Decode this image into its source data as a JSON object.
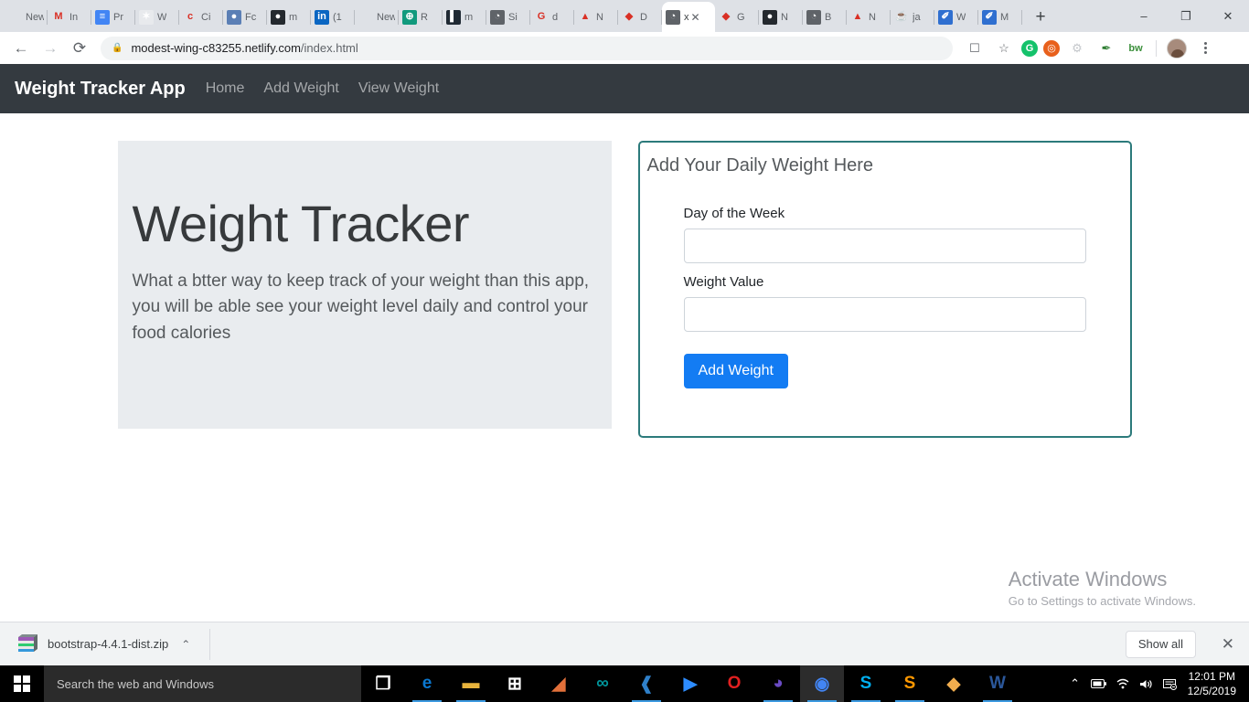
{
  "browser": {
    "tabs": [
      {
        "label": "New T",
        "icon": "blank-page-icon",
        "color": "#ffffff",
        "glyph": "",
        "active": false
      },
      {
        "label": "In",
        "icon": "gmail-icon",
        "color": "#ffffff",
        "glyph": "M",
        "active": false
      },
      {
        "label": "Pr",
        "icon": "google-docs-icon",
        "color": "#4285f4",
        "glyph": "≡",
        "active": false
      },
      {
        "label": "W",
        "icon": "asterisk-icon",
        "color": "#e8eaed",
        "glyph": "✶",
        "active": false
      },
      {
        "label": "Ci",
        "icon": "terminal-icon",
        "color": "#ffffff",
        "glyph": "c",
        "active": false
      },
      {
        "label": "Fc",
        "icon": "oval-icon",
        "color": "#5b7fb5",
        "glyph": "●",
        "active": false
      },
      {
        "label": "m",
        "icon": "github-icon",
        "color": "#24292e",
        "glyph": "●",
        "active": false
      },
      {
        "label": "(1",
        "icon": "linkedin-icon",
        "color": "#0a66c2",
        "glyph": "in",
        "active": false
      },
      {
        "label": "New T",
        "icon": "blank-page-icon",
        "color": "#ffffff",
        "glyph": "",
        "active": false
      },
      {
        "label": "R",
        "icon": "green-globe-icon",
        "color": "#119a7d",
        "glyph": "⊕",
        "active": false
      },
      {
        "label": "m",
        "icon": "dark-book-icon",
        "color": "#1f2933",
        "glyph": "▌",
        "active": false
      },
      {
        "label": "Si",
        "icon": "globe-icon",
        "color": "#5f6368",
        "glyph": "◔",
        "active": false
      },
      {
        "label": "d",
        "icon": "google-icon",
        "color": "#ffffff",
        "glyph": "G",
        "active": false
      },
      {
        "label": "N",
        "icon": "orange-lamp-icon",
        "color": "#ffffff",
        "glyph": "▲",
        "active": false
      },
      {
        "label": "D",
        "icon": "teal-diamond-icon",
        "color": "#ffffff",
        "glyph": "◆",
        "active": false
      },
      {
        "label": "x",
        "icon": "globe-icon",
        "color": "#5f6368",
        "glyph": "◔",
        "active": true
      },
      {
        "label": "G",
        "icon": "teal-diamond-icon",
        "color": "#ffffff",
        "glyph": "◆",
        "active": false
      },
      {
        "label": "N",
        "icon": "github-icon",
        "color": "#24292e",
        "glyph": "●",
        "active": false
      },
      {
        "label": "B",
        "icon": "globe-icon",
        "color": "#5f6368",
        "glyph": "◔",
        "active": false
      },
      {
        "label": "N",
        "icon": "orange-lamp-icon",
        "color": "#ffffff",
        "glyph": "▲",
        "active": false
      },
      {
        "label": "ja",
        "icon": "java-icon",
        "color": "#ffffff",
        "glyph": "☕",
        "active": false
      },
      {
        "label": "W",
        "icon": "blue-w-icon",
        "color": "#2f6fd0",
        "glyph": "✐",
        "active": false
      },
      {
        "label": "M",
        "icon": "blue-w-icon",
        "color": "#2f6fd0",
        "glyph": "✐",
        "active": false
      }
    ],
    "new_tab_label": "+",
    "window_controls": {
      "minimize": "–",
      "maximize": "❐",
      "close": "✕"
    },
    "nav": {
      "back": "←",
      "forward": "→",
      "reload": "⟳"
    },
    "address": {
      "lock_icon": "lock-icon",
      "domain": "modest-wing-c83255.netlify.com",
      "path": "/index.html"
    },
    "toolbar_icons": [
      {
        "name": "cast-icon",
        "glyph": "❐"
      },
      {
        "name": "bookmark-star-icon",
        "glyph": "☆"
      },
      {
        "name": "grammarly-extension-icon",
        "glyph": "G"
      },
      {
        "name": "orange-extension-icon",
        "glyph": "●"
      },
      {
        "name": "gray-extension-icon",
        "glyph": "◌"
      },
      {
        "name": "mouse-extension-icon",
        "glyph": "✐"
      },
      {
        "name": "bitwarden-extension-icon",
        "glyph": "bw"
      }
    ]
  },
  "site": {
    "navbar": {
      "brand": "Weight Tracker App",
      "links": [
        {
          "label": "Home"
        },
        {
          "label": "Add Weight"
        },
        {
          "label": "View Weight"
        }
      ]
    },
    "jumbotron": {
      "title": "Weight Tracker",
      "text": "What a btter way to keep track of your weight than this app, you will be able see your weight level daily and control your food calories"
    },
    "form_card": {
      "title": "Add Your Daily Weight Here",
      "border_color": "#2c7a7b",
      "fields": [
        {
          "label": "Day of the Week",
          "value": "",
          "placeholder": ""
        },
        {
          "label": "Weight Value",
          "value": "",
          "placeholder": ""
        }
      ],
      "submit_label": "Add Weight",
      "submit_color": "#137cf3"
    }
  },
  "watermark": {
    "title": "Activate Windows",
    "subtitle": "Go to Settings to activate Windows."
  },
  "download_bar": {
    "file_name": "bootstrap-4.4.1-dist.zip",
    "chevron": "⌃",
    "show_all_label": "Show all",
    "close_label": "✕"
  },
  "taskbar": {
    "search_placeholder": "Search the web and Windows",
    "apps": [
      {
        "name": "task-view-icon",
        "glyph": "❐",
        "color": "#ffffff",
        "running": false,
        "active": false
      },
      {
        "name": "edge-icon",
        "glyph": "e",
        "color": "#0b78d0",
        "running": true,
        "active": false
      },
      {
        "name": "file-explorer-icon",
        "glyph": "▬",
        "color": "#e8b33c",
        "running": true,
        "active": false
      },
      {
        "name": "microsoft-store-icon",
        "glyph": "⊞",
        "color": "#ffffff",
        "running": false,
        "active": false
      },
      {
        "name": "matlab-icon",
        "glyph": "◢",
        "color": "#e2703a",
        "running": false,
        "active": false
      },
      {
        "name": "arduino-icon",
        "glyph": "∞",
        "color": "#00979d",
        "running": false,
        "active": false
      },
      {
        "name": "vscode-icon",
        "glyph": "❰",
        "color": "#2f80c9",
        "running": true,
        "active": false
      },
      {
        "name": "zoom-icon",
        "glyph": "▶",
        "color": "#2d8cff",
        "running": false,
        "active": false
      },
      {
        "name": "opera-icon",
        "glyph": "O",
        "color": "#e02020",
        "running": false,
        "active": false
      },
      {
        "name": "moon-app-icon",
        "glyph": "◕",
        "color": "#6a4bc4",
        "running": true,
        "active": false
      },
      {
        "name": "chrome-icon",
        "glyph": "◉",
        "color": "#4285f4",
        "running": true,
        "active": true
      },
      {
        "name": "skype-icon",
        "glyph": "S",
        "color": "#00aff0",
        "running": true,
        "active": false
      },
      {
        "name": "sublime-text-icon",
        "glyph": "S",
        "color": "#ff9800",
        "running": true,
        "active": false
      },
      {
        "name": "paint-3d-icon",
        "glyph": "◆",
        "color": "#f0ad4e",
        "running": false,
        "active": false
      },
      {
        "name": "word-icon",
        "glyph": "W",
        "color": "#2b579a",
        "running": true,
        "active": false
      }
    ],
    "tray": [
      {
        "name": "show-hidden-icons-chevron",
        "glyph": "⌃"
      },
      {
        "name": "battery-icon",
        "glyph": "▭"
      },
      {
        "name": "wifi-icon",
        "glyph": "◠"
      },
      {
        "name": "volume-icon",
        "glyph": "◂"
      },
      {
        "name": "action-center-icon",
        "glyph": "⌸"
      }
    ],
    "time": "12:01 PM",
    "date": "12/5/2019"
  }
}
